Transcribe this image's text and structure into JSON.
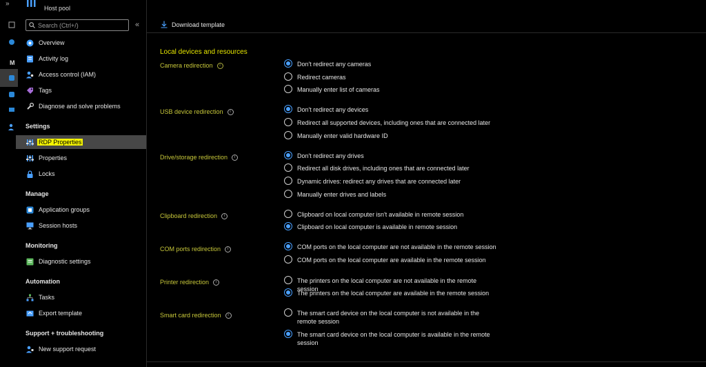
{
  "header": {
    "resource_type": "Host pool"
  },
  "search": {
    "placeholder": "Search (Ctrl+/)",
    "collapse_glyph": "«"
  },
  "nav": {
    "top": [
      {
        "label": "Overview",
        "icon": "overview-icon",
        "color": "#3f9eff"
      },
      {
        "label": "Activity log",
        "icon": "activity-log-icon",
        "color": "#4aa0ff"
      },
      {
        "label": "Access control (IAM)",
        "icon": "iam-icon",
        "color": "#4aa0ff"
      },
      {
        "label": "Tags",
        "icon": "tag-icon",
        "color": "#a66cd8"
      },
      {
        "label": "Diagnose and solve problems",
        "icon": "wrench-icon",
        "color": "#cccccc"
      }
    ],
    "sections": [
      {
        "title": "Settings",
        "items": [
          {
            "label": "RDP Properties",
            "icon": "sliders-icon",
            "selected": true
          },
          {
            "label": "Properties",
            "icon": "sliders-icon"
          },
          {
            "label": "Locks",
            "icon": "lock-icon"
          }
        ]
      },
      {
        "title": "Manage",
        "items": [
          {
            "label": "Application groups",
            "icon": "app-group-icon"
          },
          {
            "label": "Session hosts",
            "icon": "monitor-icon"
          }
        ]
      },
      {
        "title": "Monitoring",
        "items": [
          {
            "label": "Diagnostic settings",
            "icon": "diagnostic-icon"
          }
        ]
      },
      {
        "title": "Automation",
        "items": [
          {
            "label": "Tasks",
            "icon": "tasks-icon"
          },
          {
            "label": "Export template",
            "icon": "export-icon"
          }
        ]
      },
      {
        "title": "Support + troubleshooting",
        "items": [
          {
            "label": "New support request",
            "icon": "support-icon"
          }
        ]
      }
    ]
  },
  "toolbar": {
    "download_label": "Download template"
  },
  "content": {
    "section_title": "Local devices and resources",
    "properties": [
      {
        "label": "Camera redirection",
        "options": [
          {
            "text": "Don't redirect any cameras",
            "selected": true
          },
          {
            "text": "Redirect cameras",
            "selected": false
          },
          {
            "text": "Manually enter list of cameras",
            "selected": false
          }
        ]
      },
      {
        "label": "USB device redirection",
        "options": [
          {
            "text": "Don't redirect any devices",
            "selected": true
          },
          {
            "text": "Redirect all supported devices, including ones that are connected later",
            "selected": false
          },
          {
            "text": "Manually enter valid hardware ID",
            "selected": false
          }
        ]
      },
      {
        "label": "Drive/storage redirection",
        "options": [
          {
            "text": "Don't redirect any drives",
            "selected": true
          },
          {
            "text": "Redirect all disk drives, including ones that are connected later",
            "selected": false
          },
          {
            "text": "Dynamic drives: redirect any drives that are connected later",
            "selected": false
          },
          {
            "text": "Manually enter drives and labels",
            "selected": false
          }
        ]
      },
      {
        "label": "Clipboard redirection",
        "options": [
          {
            "text": "Clipboard on local computer isn't available in remote session",
            "selected": false
          },
          {
            "text": "Clipboard on local computer is available in remote session",
            "selected": true
          }
        ]
      },
      {
        "label": "COM ports redirection",
        "options": [
          {
            "text": "COM ports on the local computer are not available in the remote session",
            "selected": true
          },
          {
            "text": "COM ports on the local computer are available in the remote session",
            "selected": false
          }
        ]
      },
      {
        "label": "Printer redirection",
        "options": [
          {
            "text": "The printers on the local computer are not available in the remote session",
            "selected": false
          },
          {
            "text": "The printers on the local computer are available in the remote session",
            "selected": true
          }
        ]
      },
      {
        "label": "Smart card redirection",
        "options": [
          {
            "text": "The smart card device on the local computer is not available in the remote session",
            "selected": false
          },
          {
            "text": "The smart card device on the local computer is available in the remote session",
            "selected": true
          }
        ]
      }
    ]
  },
  "colors": {
    "accent": "#4aa0ff",
    "highlight": "#f4f402",
    "label": "#c8c83a"
  }
}
